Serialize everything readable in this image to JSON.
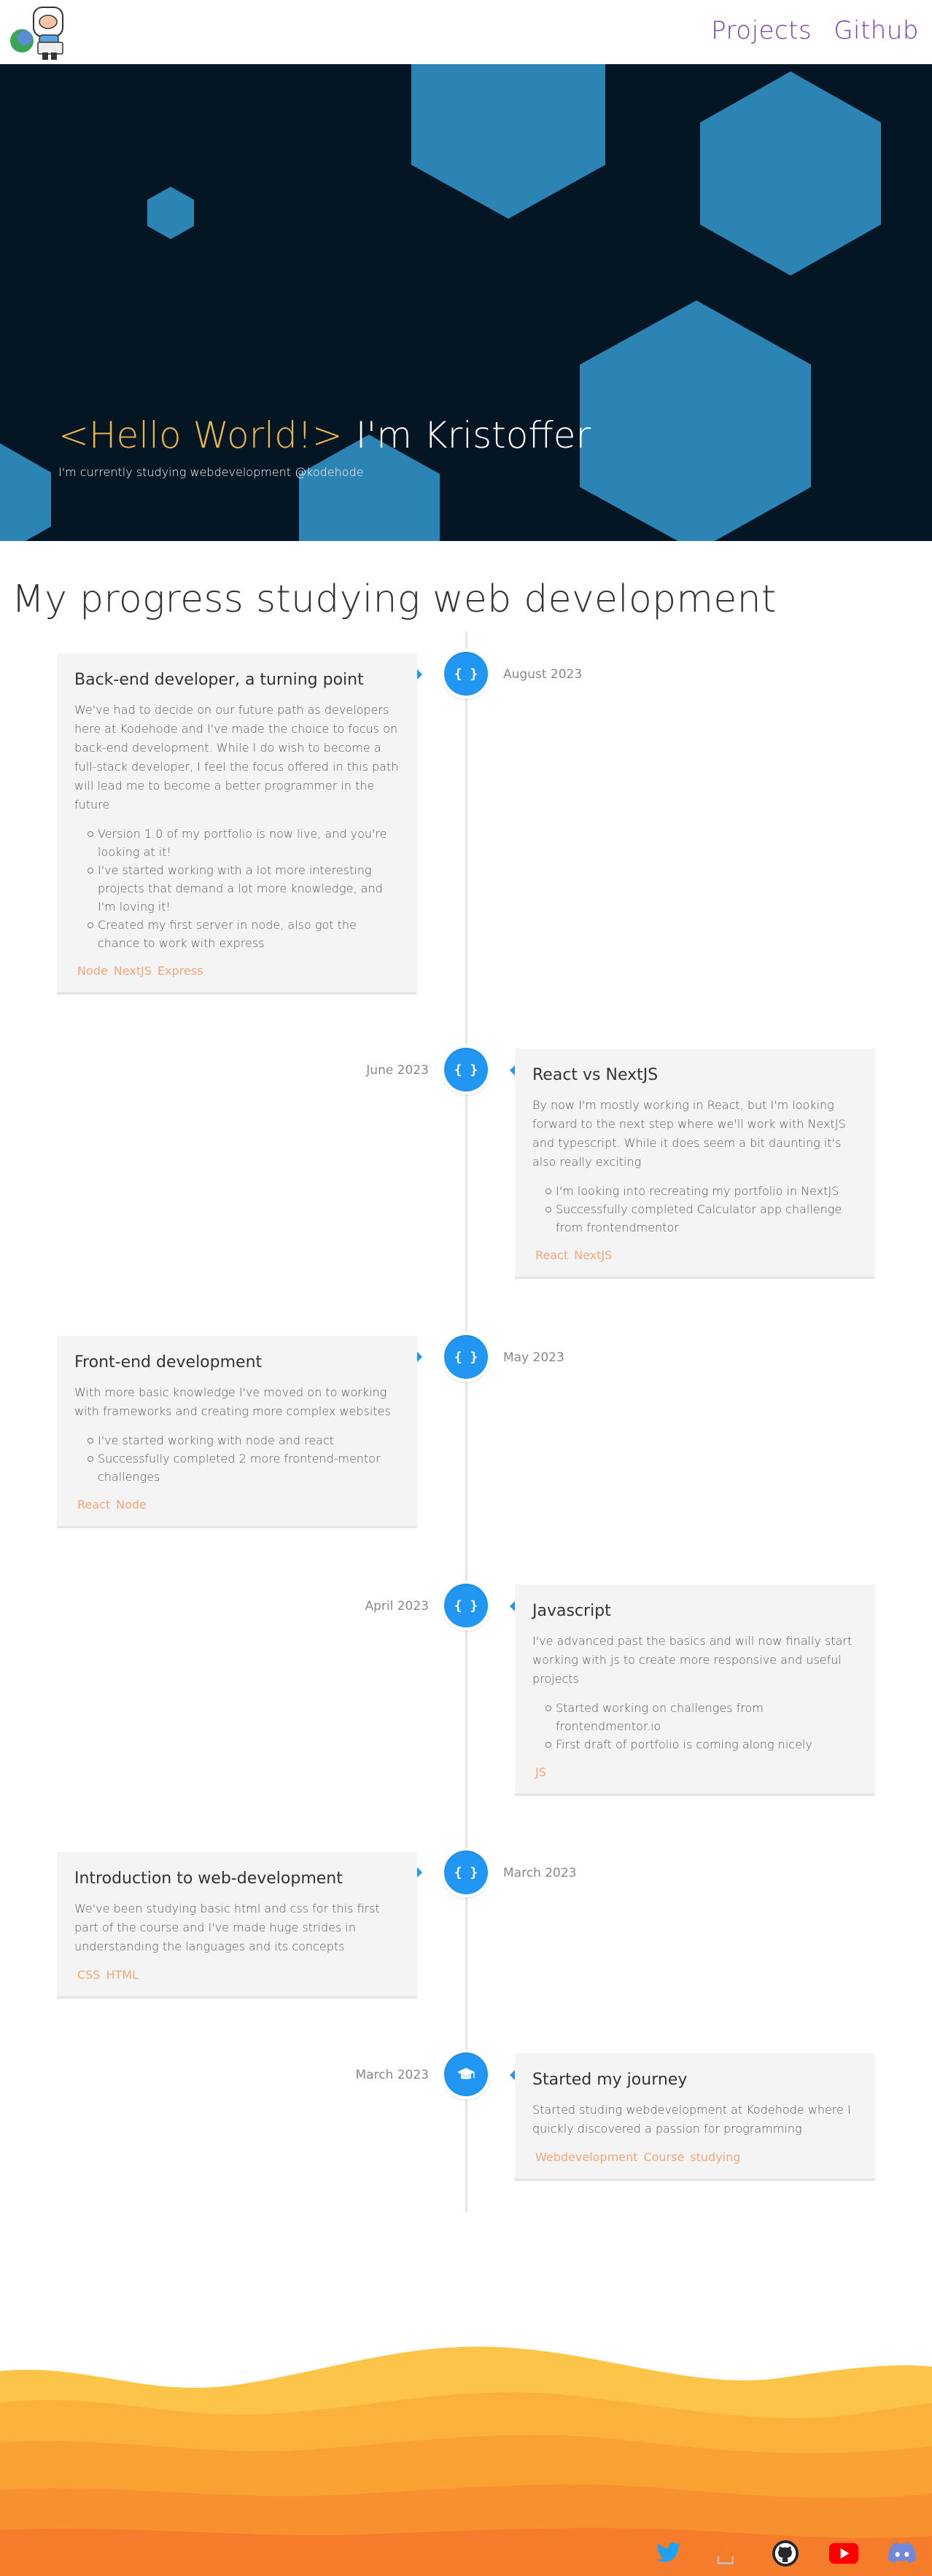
{
  "nav": {
    "projects": "Projects",
    "github": "Github"
  },
  "hero": {
    "hello": "<Hello World!>",
    "name": "I'm Kristoffer",
    "subtitle": "I'm currently studying webdevelopment @kodehode"
  },
  "section_title": "My progress studying web development",
  "timeline": [
    {
      "date": "August 2023",
      "icon": "code-icon",
      "title": "Back-end developer, a turning point",
      "text": "We've had to decide on our future path as developers here at Kodehode and I've made the choice to focus on back-end development. While I do wish to become a full-stack developer, I feel the focus offered in this path will lead me to become a better programmer in the future",
      "bullets": [
        "Version 1.0 of my portfolio is now live, and you're looking at it!",
        "I've started working with a lot more interesting projects that demand a lot more knowledge, and I'm loving it!",
        "Created my first server in node, also got the chance to work with express"
      ],
      "tags": [
        "Node",
        "NextJS",
        "Express"
      ]
    },
    {
      "date": "June 2023",
      "icon": "code-icon",
      "title": "React vs NextJS",
      "text": "By now I'm mostly working in React, but I'm looking forward to the next step where we'll work with NextJS and typescript. While it does seem a bit daunting it's also really exciting",
      "bullets": [
        "I'm looking into recreating my portfolio in NextJS",
        "Successfully completed Calculator app challenge from frontendmentor"
      ],
      "tags": [
        "React",
        "NextJS"
      ]
    },
    {
      "date": "May 2023",
      "icon": "code-icon",
      "title": "Front-end development",
      "text": "With more basic knowledge I've moved on to working with frameworks and creating more complex websites",
      "bullets": [
        "I've started working with node and react",
        "Successfully completed 2 more frontend-mentor challenges"
      ],
      "tags": [
        "React",
        "Node"
      ]
    },
    {
      "date": "April 2023",
      "icon": "code-icon",
      "title": "Javascript",
      "text": "I've advanced past the basics and will now finally start working with js to create more responsive and useful projects",
      "bullets": [
        "Started working on challenges from frontendmentor.io",
        "First draft of portfolio is coming along nicely"
      ],
      "tags": [
        "JS"
      ]
    },
    {
      "date": "March 2023",
      "icon": "code-icon",
      "title": "Introduction to web-development",
      "text": "We've been studying basic html and css for this first part of the course and I've made huge strides in understanding the languages and its concepts",
      "bullets": [],
      "tags": [
        "CSS",
        "HTML"
      ]
    },
    {
      "date": "March 2023",
      "icon": "graduation-cap-icon",
      "title": "Started my journey",
      "text": "Started studing webdevelopment at Kodehode where I quickly discovered a passion for programming",
      "bullets": [],
      "tags": [
        "Webdevelopment",
        "Course",
        "studying"
      ]
    }
  ],
  "social": [
    {
      "name": "twitter-icon",
      "color": "#1da1f2"
    },
    {
      "name": "stackoverflow-icon",
      "color": "#f48024"
    },
    {
      "name": "github-icon",
      "color": "#24292e"
    },
    {
      "name": "youtube-icon",
      "color": "#ff0000"
    },
    {
      "name": "discord-icon",
      "color": "#7289da"
    }
  ],
  "colors": {
    "accent": "#2196f3",
    "nav": "#7b3fa8",
    "hello": "#e8b64a",
    "hero_bg": "#041523",
    "hex": "#2b84b3",
    "tag": "#f2a77a"
  }
}
